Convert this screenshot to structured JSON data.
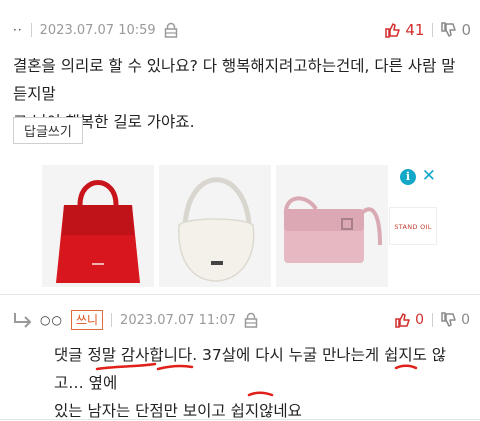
{
  "comment1": {
    "nickname": "··",
    "date": "2023.07.07 10:59",
    "upvotes": "41",
    "downvotes": "0",
    "body_line1": "결혼을 의리로 할 수 있나요? 다 행복해지려고하는건데, 다른 사람 말 듣지말",
    "body_line2": "고 님이 행복한 길로 가야죠.",
    "reply_button": "답글쓰기"
  },
  "ad": {
    "info_label": "i",
    "close_label": "✕",
    "brand": "STAND OIL"
  },
  "comment2": {
    "nickname": "○○",
    "badge": "쓰니",
    "date": "2023.07.07 11:07",
    "upvotes": "0",
    "downvotes": "0",
    "body_line1": "댓글 정말 감사합니다. 37살에 다시 누굴 만나는게 쉽지도 않고… 옆에",
    "body_line2": "있는 남자는 단점만 보이고 쉽지않네요"
  },
  "colors": {
    "upvote": "#d32f2f",
    "badge": "#e0531f",
    "ad_accent": "#14a8c8",
    "handwriting_underline": "#e0201a"
  },
  "icons": {
    "lock": "lock-icon",
    "thumb_up": "thumb-up-icon",
    "thumb_down": "thumb-down-icon",
    "reply": "reply-arrow-icon"
  }
}
